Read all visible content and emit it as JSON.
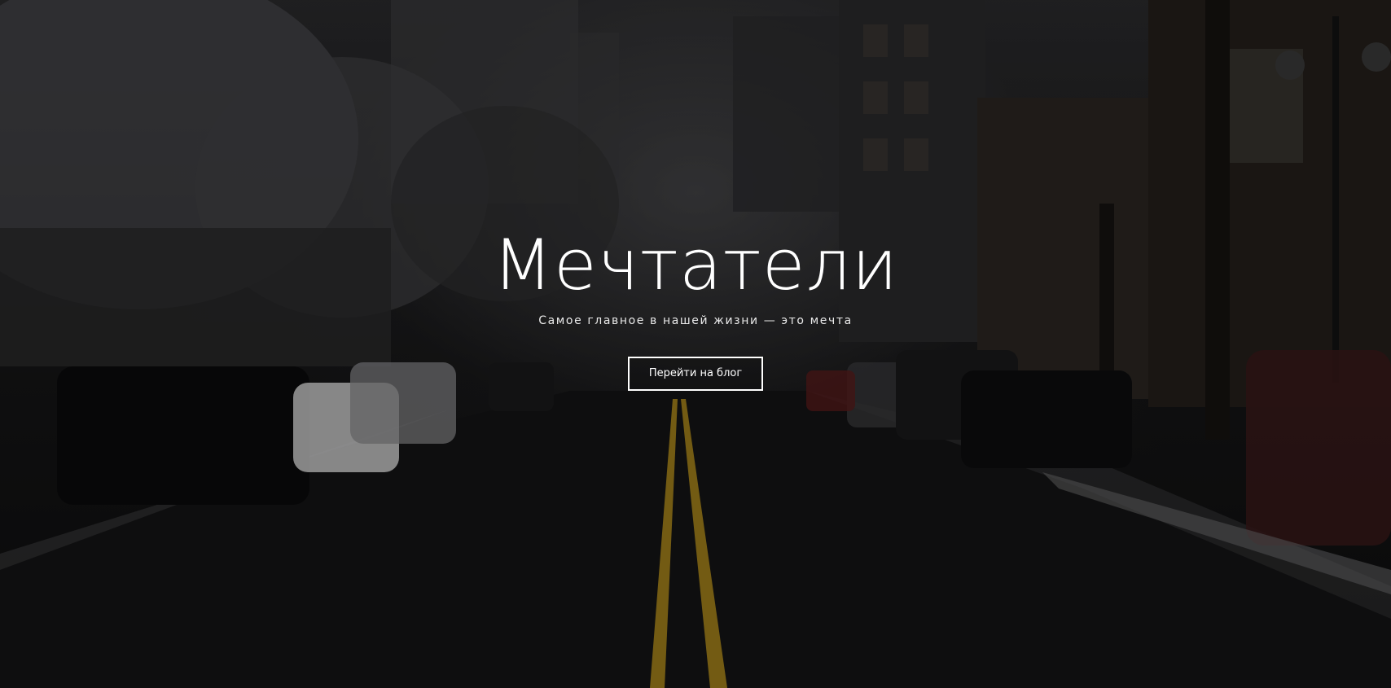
{
  "hero": {
    "title": "Мечтатели",
    "tagline": "Самое главное в нашей жизни — это мечта",
    "cta_label": "Перейти на блог"
  },
  "theme": {
    "text_color": "#ffffff",
    "overlay_color": "#000000"
  },
  "background": {
    "scene": "snowy-city-street-photo"
  }
}
